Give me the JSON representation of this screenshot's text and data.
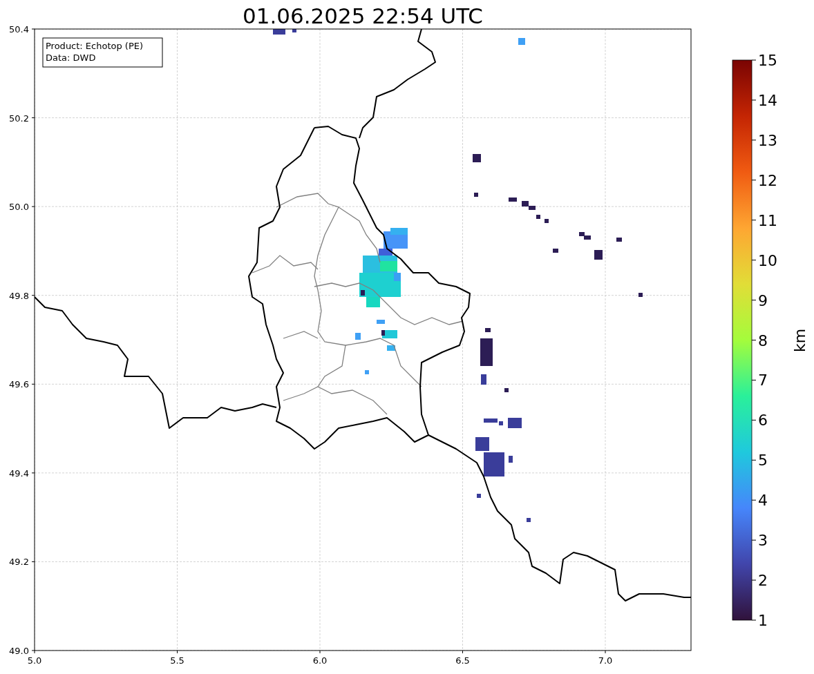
{
  "title": "01.06.2025 22:54 UTC",
  "legend": [
    "Product: Echotop (PE)",
    "Data: DWD"
  ],
  "x_axis": {
    "ticks": [
      "5.0",
      "5.5",
      "6.0",
      "6.5",
      "7.0"
    ]
  },
  "y_axis": {
    "ticks": [
      "50.4",
      "50.2",
      "50.0",
      "49.8",
      "49.6",
      "49.4",
      "49.2",
      "49.0"
    ]
  },
  "colorbar": {
    "label": "km",
    "ticks": [
      "15",
      "14",
      "13",
      "12",
      "11",
      "10",
      "9",
      "8",
      "7",
      "6",
      "5",
      "4",
      "3",
      "2",
      "1"
    ]
  }
}
